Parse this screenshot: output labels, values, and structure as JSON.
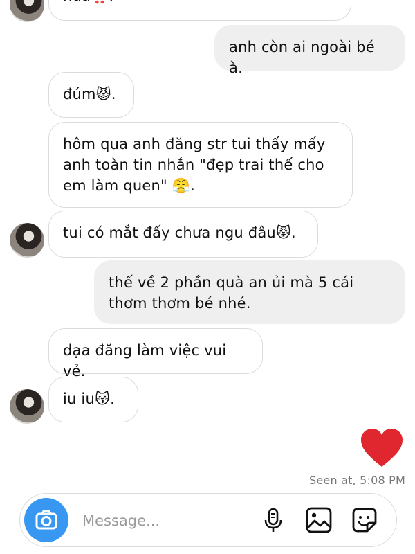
{
  "thread": {
    "messages": [
      {
        "side": "in",
        "parts": [
          {
            "t": "nữa"
          },
          {
            "e": "‼️"
          },
          {
            "t": "."
          }
        ]
      },
      {
        "side": "out",
        "parts": [
          {
            "t": "anh còn ai ngoài bé à."
          }
        ]
      },
      {
        "side": "in",
        "parts": [
          {
            "t": "đúm"
          },
          {
            "e": "😾"
          },
          {
            "t": "."
          }
        ]
      },
      {
        "side": "in",
        "parts": [
          {
            "t": "hôm qua anh đăng str tui thấy mấy anh toàn tin nhắn \"đẹp trai thế cho em làm quen\" "
          },
          {
            "e": "😤"
          },
          {
            "t": "."
          }
        ]
      },
      {
        "side": "in",
        "parts": [
          {
            "t": "tui có mắt đấy chưa ngu đâu"
          },
          {
            "e": "😾"
          },
          {
            "t": "."
          }
        ]
      },
      {
        "side": "out",
        "parts": [
          {
            "t": "thế về 2 phần quà an ủi mà 5 cái thơm thơm bé nhé."
          }
        ]
      },
      {
        "side": "in",
        "parts": [
          {
            "t": "dạa đăng làm việc vui vẻ."
          }
        ]
      },
      {
        "side": "in",
        "parts": [
          {
            "t": "iu iu"
          },
          {
            "e": "😽"
          },
          {
            "t": "."
          }
        ]
      }
    ],
    "reaction": "heart",
    "seen_text": "Seen at, 5:08 PM"
  },
  "composer": {
    "placeholder": "Message...",
    "value": ""
  },
  "icons": {
    "camera": "camera-icon",
    "mic": "microphone-icon",
    "gallery": "gallery-icon",
    "sticker": "sticker-icon"
  },
  "colors": {
    "accent": "#3897f0",
    "heart": "#e0262e",
    "outgoing_bubble": "#efefef",
    "incoming_border": "#dbdbdb"
  }
}
